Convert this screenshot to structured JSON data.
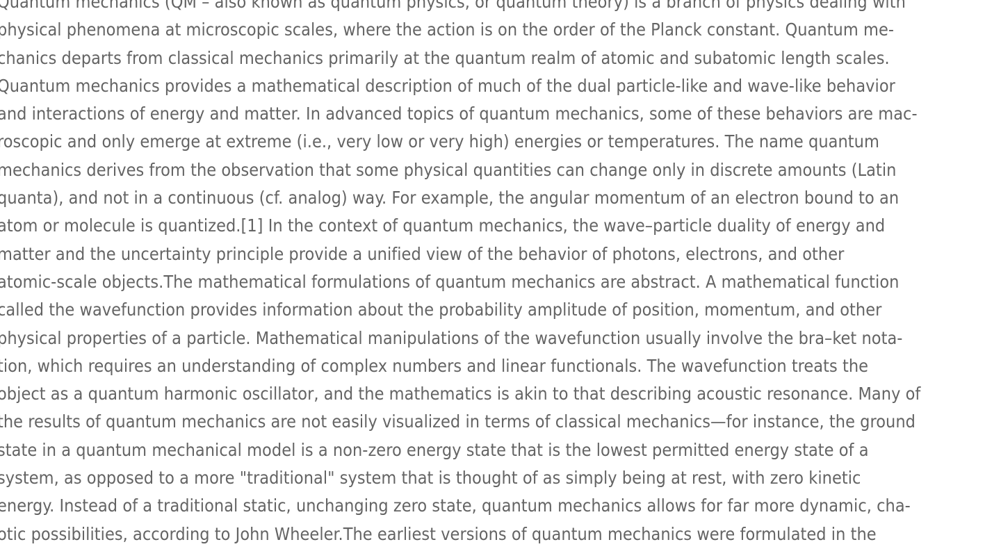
{
  "document": {
    "lines": [
      "Quantum mechanics (QM – also known as quantum physics, or quantum theory) is a branch of physics dealing with",
      "physical phenomena at microscopic scales, where the action is on the order of the Planck constant. Quantum me-",
      "chanics departs from classical mechanics primarily at the quantum realm of atomic and subatomic length scales.",
      "Quantum mechanics provides a mathematical description of much of the dual particle-like and wave-like behavior",
      "and interactions of energy and matter. In advanced topics of quantum mechanics, some of these behaviors are mac-",
      "roscopic and only emerge at extreme (i.e., very low or very high) energies or temperatures. The name quantum",
      "mechanics derives from the observation that some physical quantities can change only in discrete amounts (Latin",
      "quanta), and not in a continuous (cf. analog) way. For example, the angular momentum of an electron bound to an",
      "atom or molecule is quantized.[1] In the context of quantum mechanics, the wave–particle duality of energy and",
      "matter and the uncertainty principle provide a unified view of the behavior of photons, electrons, and other",
      "atomic-scale objects.The mathematical formulations of quantum mechanics are abstract. A mathematical function",
      "called the wavefunction provides information about the probability amplitude of position, momentum, and other",
      "physical properties of a particle. Mathematical manipulations of the wavefunction usually involve the bra–ket nota-",
      "tion, which requires an understanding of complex numbers and linear functionals. The wavefunction treats the",
      "object as a quantum harmonic oscillator, and the mathematics is akin to that describing acoustic resonance. Many of",
      "the results of quantum mechanics are not easily visualized in terms of classical mechanics—for instance, the ground",
      "state in a quantum mechanical model is a non-zero energy state that is the lowest permitted energy state of a",
      "system, as opposed to a more \"traditional\" system that is thought of as simply being at rest, with zero kinetic",
      "energy. Instead of a traditional static, unchanging zero state, quantum mechanics allows for far more dynamic, cha-",
      "otic possibilities, according to John Wheeler.The earliest versions of quantum mechanics were formulated in the"
    ]
  }
}
